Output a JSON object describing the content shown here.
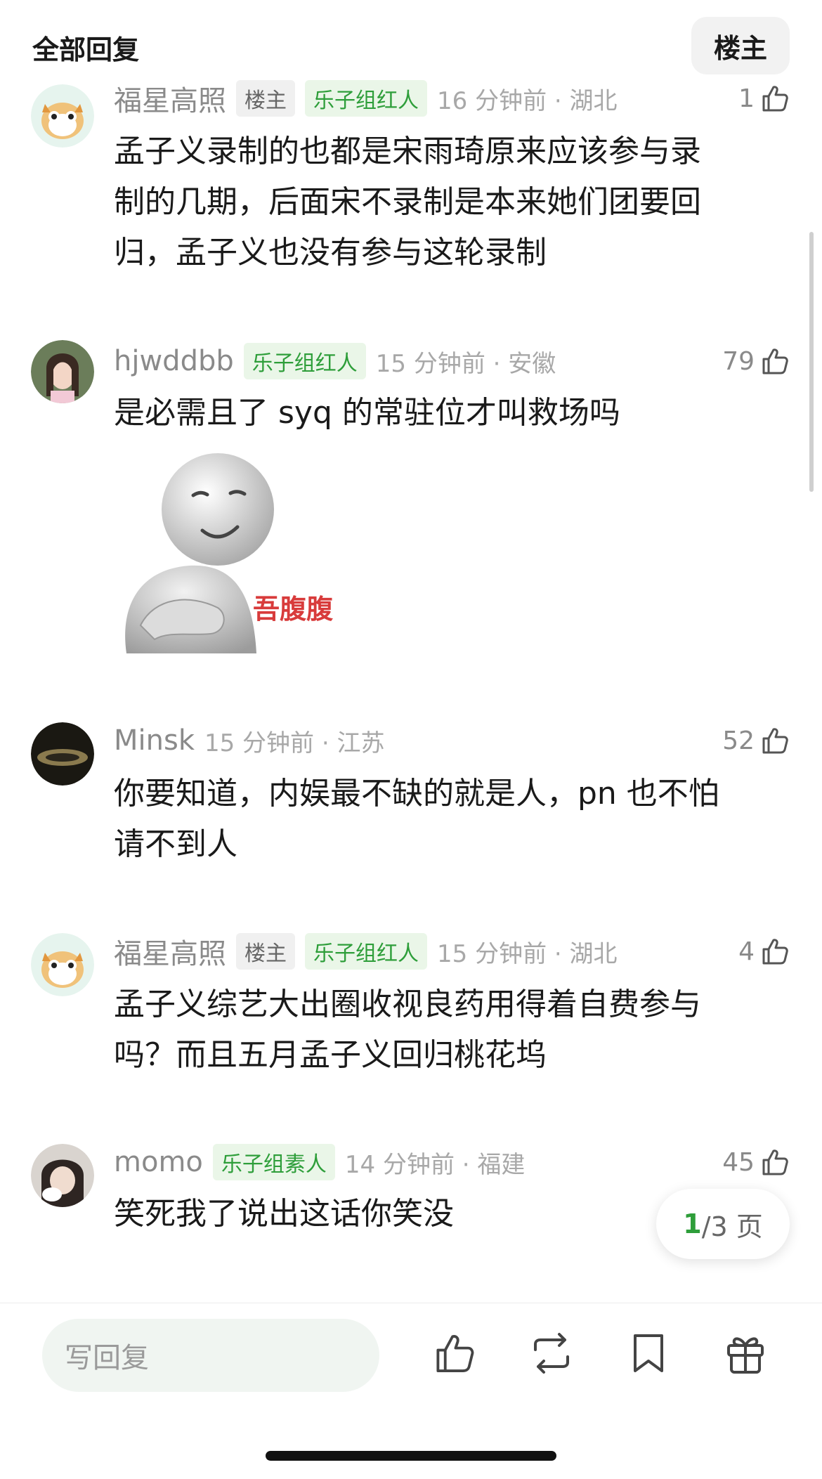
{
  "header": {
    "title": "全部回复",
    "op_button": "楼主"
  },
  "comments": [
    {
      "username": "福星高照",
      "tags": {
        "op": "楼主",
        "badge": "乐子组红人"
      },
      "time_location": "16 分钟前 · 湖北",
      "likes": "1",
      "text_lines": [
        "孟子义录制的也都是宋雨琦原来应该参与录",
        "制的几期，后面宋不录制是本来她们团要回",
        "归，孟子义也没有参与这轮录制"
      ]
    },
    {
      "username": "hjwddbb",
      "tags": {
        "badge": "乐子组红人"
      },
      "time_location": "15 分钟前 · 安徽",
      "likes": "79",
      "text_lines": [
        "是必需且了 syq 的常驻位才叫救场吗"
      ],
      "sticker_text": "吾腹腹"
    },
    {
      "username": "Minsk",
      "time_location": "15 分钟前 · 江苏",
      "likes": "52",
      "text_lines": [
        "你要知道，内娱最不缺的就是人，pn 也不怕",
        "请不到人"
      ]
    },
    {
      "username": "福星高照",
      "tags": {
        "op": "楼主",
        "badge": "乐子组红人"
      },
      "time_location": "15 分钟前 · 湖北",
      "likes": "4",
      "text_lines": [
        "孟子义综艺大出圈收视良药用得着自费参与",
        "吗？而且五月孟子义回归桃花坞"
      ]
    },
    {
      "username": "momo",
      "tags": {
        "badge": "乐子组素人"
      },
      "time_location": "14 分钟前 · 福建",
      "likes": "45",
      "text_lines": [
        "笑死我了说出这话你笑没"
      ]
    }
  ],
  "pagination": {
    "current": "1",
    "total": "/3 页"
  },
  "bottom_bar": {
    "reply_placeholder": "写回复"
  },
  "colors": {
    "accent_green": "#2e9e3a",
    "badge_bg": "#eaf6e8"
  },
  "icons": [
    "thumbs-up-icon",
    "repost-icon",
    "bookmark-icon",
    "gift-icon"
  ]
}
